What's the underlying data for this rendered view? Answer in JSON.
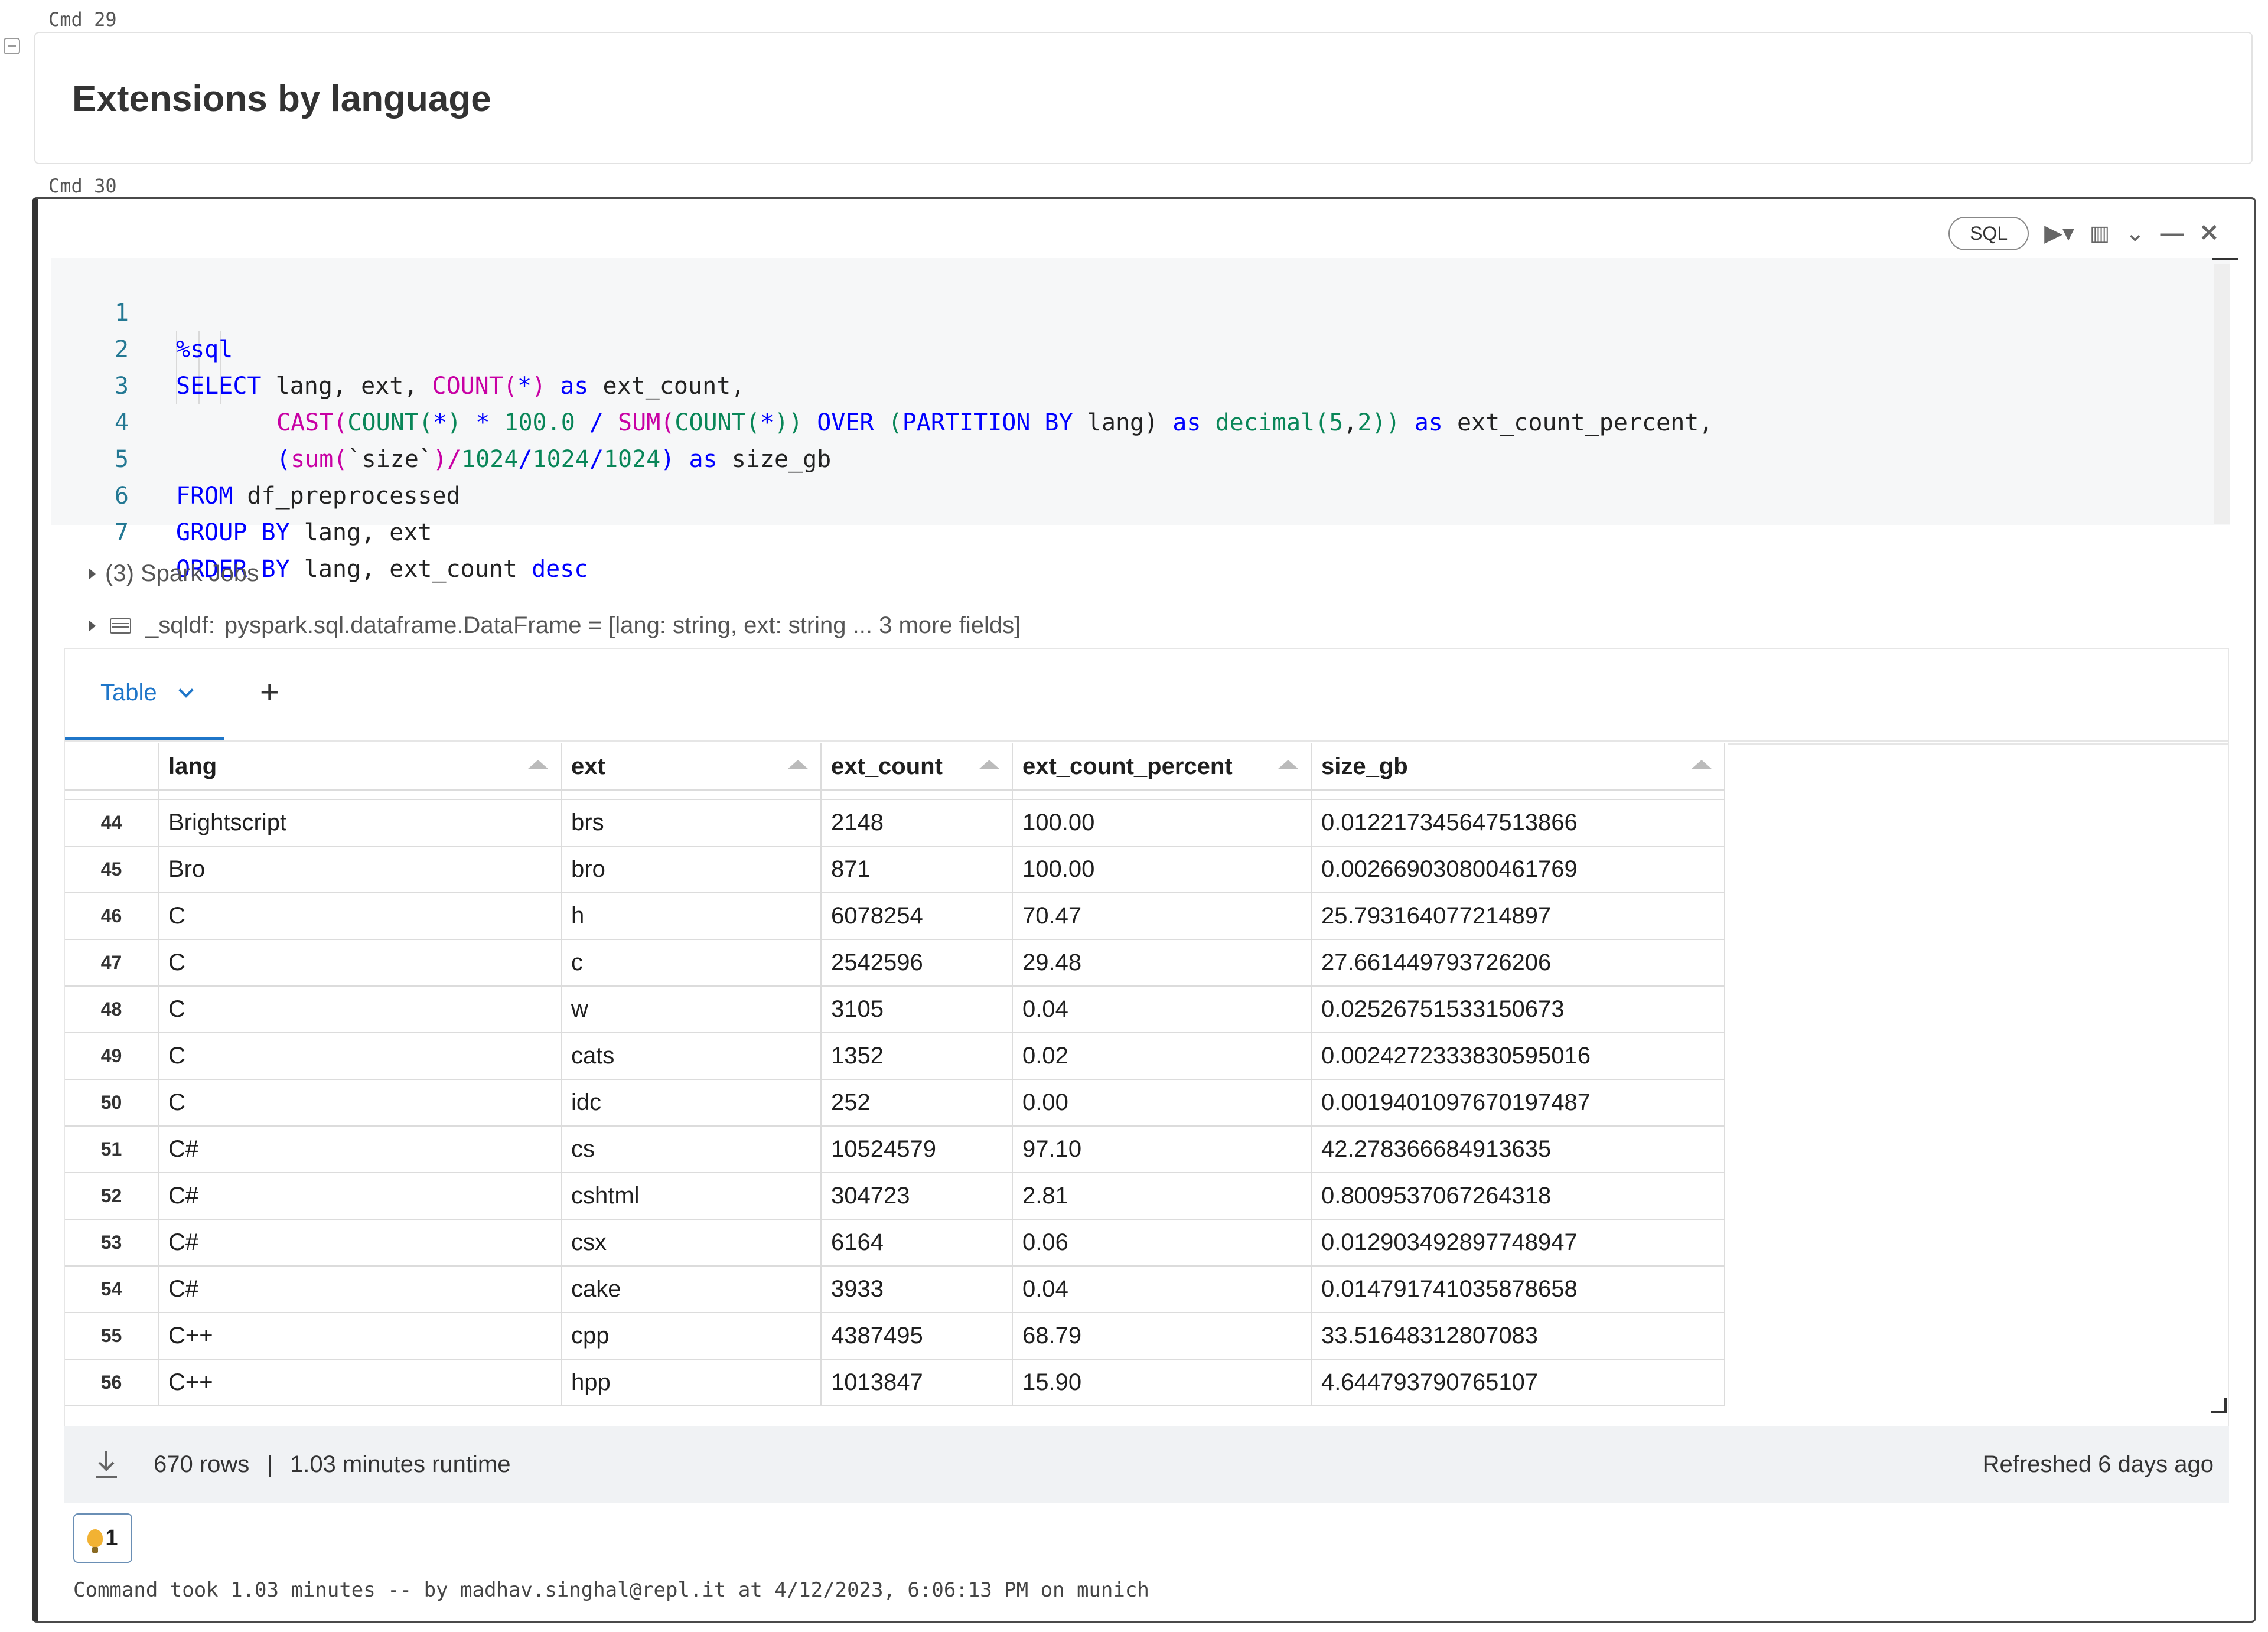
{
  "cells": {
    "md_cmd": "Cmd 29",
    "md_title": "Extensions by language",
    "code_cmd": "Cmd 30"
  },
  "toolbar": {
    "language": "SQL",
    "icons": [
      "run-dropdown-icon",
      "chart-icon",
      "collapse-chevron-icon",
      "minimize-icon",
      "close-icon"
    ]
  },
  "code": {
    "line_numbers": [
      "1",
      "2",
      "3",
      "4",
      "5",
      "6",
      "7"
    ],
    "l1": "%sql",
    "l2_select": "SELECT",
    "l2_rest": " lang, ext, ",
    "l2_count": "COUNT(",
    "l2_star": "*",
    "l2_close": ")",
    "l2_as": " as",
    "l2_tail": " ext_count,",
    "l3_cast": "CAST",
    "l3_p1": "(",
    "l3_count": "COUNT(",
    "l3_star": "*",
    "l3_close": ")",
    "l3_mul": " * ",
    "l3_100": "100.0",
    "l3_div": " / ",
    "l3_sum": "SUM(",
    "l3_count2": "COUNT(",
    "l3_star2": "*",
    "l3_close2": "))",
    "l3_over": " OVER ",
    "l3_p2": "(",
    "l3_partition": "PARTITION BY",
    "l3_lang": " lang)",
    "l3_as": " as ",
    "l3_decimal": "decimal(",
    "l3_5": "5",
    "l3_comma": ",",
    "l3_2": "2",
    "l3_cl": "))",
    "l3_as2": " as",
    "l3_tail": " ext_count_percent,",
    "l4_open": "(",
    "l4_sum": "sum(",
    "l4_size": "`size`",
    "l4_div1": ")/",
    "l4_n1": "1024",
    "l4_div2": "/",
    "l4_n2": "1024",
    "l4_div3": "/",
    "l4_n3": "1024",
    "l4_close": ")",
    "l4_as": " as",
    "l4_tail": " size_gb",
    "l5_from": "FROM",
    "l5_tail": " df_preprocessed",
    "l6_group": "GROUP BY",
    "l6_tail": " lang, ext",
    "l7_order": "ORDER BY",
    "l7_mid": " lang, ext_count ",
    "l7_desc": "desc"
  },
  "spark_jobs": "(3) Spark Jobs",
  "sqldf": {
    "name": "_sqldf:",
    "type": "pyspark.sql.dataframe.DataFrame = [lang: string, ext: string ... 3 more fields]"
  },
  "result": {
    "tab_label": "Table",
    "add_label": "+",
    "columns": [
      "lang",
      "ext",
      "ext_count",
      "ext_count_percent",
      "size_gb"
    ],
    "rows": [
      [
        "44",
        "Brightscript",
        "brs",
        "2148",
        "100.00",
        "0.012217345647513866"
      ],
      [
        "45",
        "Bro",
        "bro",
        "871",
        "100.00",
        "0.002669030800461769"
      ],
      [
        "46",
        "C",
        "h",
        "6078254",
        "70.47",
        "25.793164077214897"
      ],
      [
        "47",
        "C",
        "c",
        "2542596",
        "29.48",
        "27.661449793726206"
      ],
      [
        "48",
        "C",
        "w",
        "3105",
        "0.04",
        "0.02526751533150673"
      ],
      [
        "49",
        "C",
        "cats",
        "1352",
        "0.02",
        "0.0024272333830595016"
      ],
      [
        "50",
        "C",
        "idc",
        "252",
        "0.00",
        "0.0019401097670197487"
      ],
      [
        "51",
        "C#",
        "cs",
        "10524579",
        "97.10",
        "42.278366684913635"
      ],
      [
        "52",
        "C#",
        "cshtml",
        "304723",
        "2.81",
        "0.8009537067264318"
      ],
      [
        "53",
        "C#",
        "csx",
        "6164",
        "0.06",
        "0.012903492897748947"
      ],
      [
        "54",
        "C#",
        "cake",
        "3933",
        "0.04",
        "0.014791741035878658"
      ],
      [
        "55",
        "C++",
        "cpp",
        "4387495",
        "68.79",
        "33.51648312807083"
      ],
      [
        "56",
        "C++",
        "hpp",
        "1013847",
        "15.90",
        "4.644793790765107"
      ]
    ]
  },
  "footer": {
    "rows": "670 rows",
    "sep": "|",
    "runtime": "1.03 minutes runtime",
    "refreshed": "Refreshed 6 days ago"
  },
  "badge": {
    "count": "1"
  },
  "command_took": "Command took 1.03 minutes -- by madhav.singhal@repl.it at 4/12/2023, 6:06:13 PM on munich",
  "colors": {
    "accent": "#1f76c9",
    "keyword": "#0000ff",
    "function": "#c800a4",
    "number": "#098658"
  }
}
